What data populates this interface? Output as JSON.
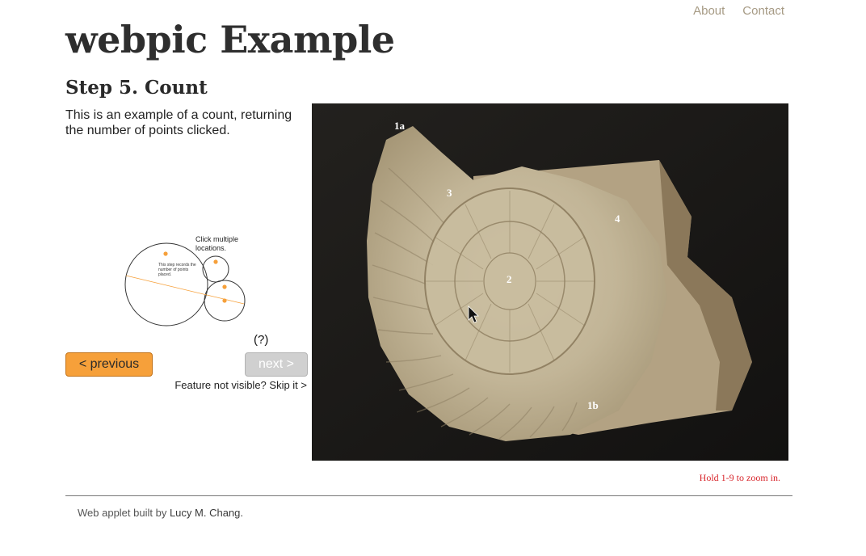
{
  "nav": {
    "about": "About",
    "contact": "Contact"
  },
  "site_title": "webpic Example",
  "step": {
    "title": "Step 5. Count",
    "description": "This is an example of a count, returning the number of points clicked.",
    "diagram_caption": "Click multiple locations.",
    "diagram_note": "This step records the number of points placed.",
    "help": "(?)",
    "previous_label": "< previous",
    "next_label": "next >",
    "skip_label": "Feature not visible? Skip it >"
  },
  "image": {
    "labels": [
      "1a",
      "3",
      "4",
      "2",
      "1b"
    ],
    "zoom_hint": "Hold 1-9 to zoom in."
  },
  "footer": {
    "prefix": "Web applet built by ",
    "author": "Lucy M. Chang."
  },
  "colors": {
    "accent_orange": "#f6a03a",
    "zoom_hint_red": "#d8252b",
    "nav_link": "#a69a84"
  }
}
